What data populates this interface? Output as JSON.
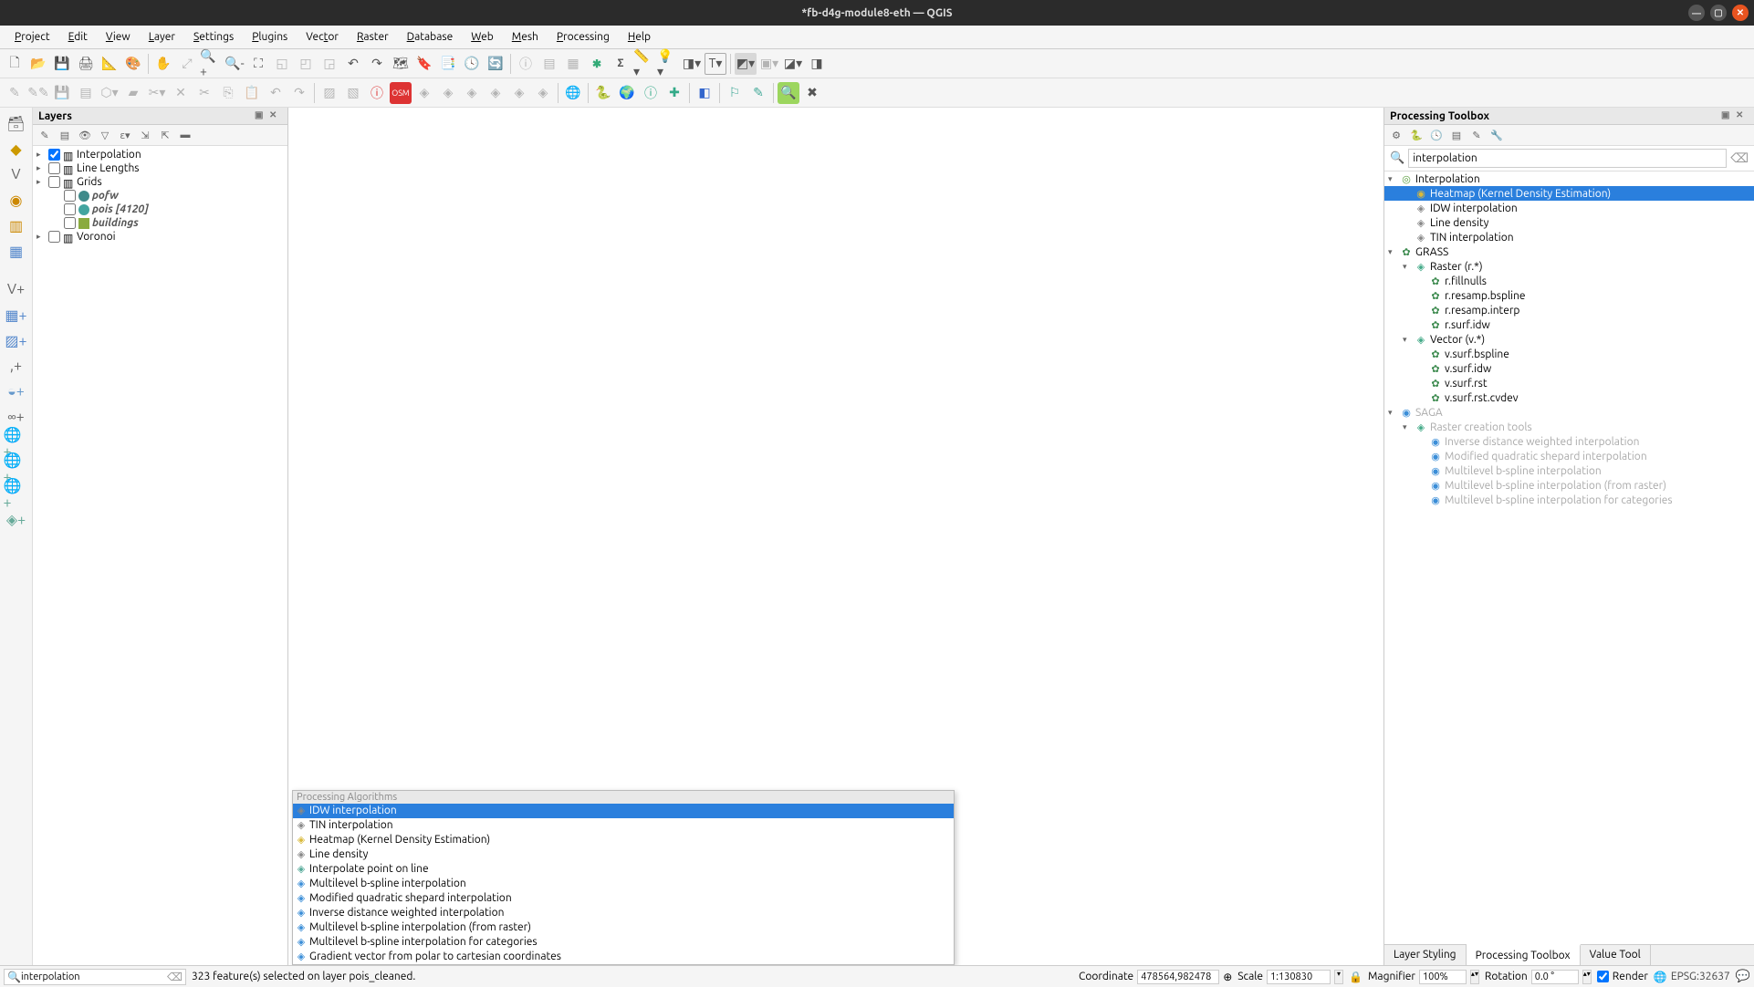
{
  "window": {
    "title": "*fb-d4g-module8-eth — QGIS"
  },
  "menubar": [
    {
      "label": "Project",
      "u": 0
    },
    {
      "label": "Edit",
      "u": 0
    },
    {
      "label": "View",
      "u": 0
    },
    {
      "label": "Layer",
      "u": 0
    },
    {
      "label": "Settings",
      "u": 0
    },
    {
      "label": "Plugins",
      "u": 0
    },
    {
      "label": "Vector",
      "u": 3
    },
    {
      "label": "Raster",
      "u": 0
    },
    {
      "label": "Database",
      "u": 0
    },
    {
      "label": "Web",
      "u": 0
    },
    {
      "label": "Mesh",
      "u": 0
    },
    {
      "label": "Processing",
      "u": 0
    },
    {
      "label": "Help",
      "u": 0
    }
  ],
  "layers_panel": {
    "title": "Layers",
    "items": [
      {
        "type": "group",
        "label": "Interpolation",
        "checked": true,
        "expandable": true
      },
      {
        "type": "group",
        "label": "Line Lengths",
        "checked": false,
        "expandable": true
      },
      {
        "type": "group",
        "label": "Grids",
        "checked": false,
        "expandable": true
      },
      {
        "type": "layer",
        "label": "pofw",
        "checked": false,
        "style": "italic",
        "sym": "point",
        "color": "#3f8a8a",
        "indent": 1
      },
      {
        "type": "layer",
        "label": "pois [4120]",
        "checked": false,
        "style": "italic",
        "sym": "point",
        "color": "#42a5a0",
        "indent": 1
      },
      {
        "type": "layer",
        "label": "buildings",
        "checked": false,
        "style": "italic",
        "sym": "rect",
        "color": "#8aab3f",
        "indent": 1
      },
      {
        "type": "group",
        "label": "Voronoi",
        "checked": false,
        "expandable": true
      }
    ]
  },
  "toolbox": {
    "title": "Processing Toolbox",
    "search_value": "interpolation",
    "tree": [
      {
        "l": 0,
        "t": "g",
        "label": "Interpolation",
        "icon": "qgis",
        "open": true
      },
      {
        "l": 1,
        "t": "a",
        "label": "Heatmap (Kernel Density Estimation)",
        "icon": "hm",
        "selected": true
      },
      {
        "l": 1,
        "t": "a",
        "label": "IDW interpolation",
        "icon": "grey"
      },
      {
        "l": 1,
        "t": "a",
        "label": "Line density",
        "icon": "grey"
      },
      {
        "l": 1,
        "t": "a",
        "label": "TIN interpolation",
        "icon": "grey"
      },
      {
        "l": 0,
        "t": "g",
        "label": "GRASS",
        "icon": "grass",
        "open": true
      },
      {
        "l": 1,
        "t": "g",
        "label": "Raster (r.*)",
        "open": true
      },
      {
        "l": 2,
        "t": "a",
        "label": "r.fillnulls",
        "icon": "grass"
      },
      {
        "l": 2,
        "t": "a",
        "label": "r.resamp.bspline",
        "icon": "grass"
      },
      {
        "l": 2,
        "t": "a",
        "label": "r.resamp.interp",
        "icon": "grass"
      },
      {
        "l": 2,
        "t": "a",
        "label": "r.surf.idw",
        "icon": "grass"
      },
      {
        "l": 1,
        "t": "g",
        "label": "Vector (v.*)",
        "open": true
      },
      {
        "l": 2,
        "t": "a",
        "label": "v.surf.bspline",
        "icon": "grass"
      },
      {
        "l": 2,
        "t": "a",
        "label": "v.surf.idw",
        "icon": "grass"
      },
      {
        "l": 2,
        "t": "a",
        "label": "v.surf.rst",
        "icon": "grass"
      },
      {
        "l": 2,
        "t": "a",
        "label": "v.surf.rst.cvdev",
        "icon": "grass"
      },
      {
        "l": 0,
        "t": "g",
        "label": "SAGA",
        "icon": "saga",
        "open": true,
        "disabled": true
      },
      {
        "l": 1,
        "t": "g",
        "label": "Raster creation tools",
        "open": true,
        "disabled": true
      },
      {
        "l": 2,
        "t": "a",
        "label": "Inverse distance weighted interpolation",
        "icon": "saga",
        "disabled": true
      },
      {
        "l": 2,
        "t": "a",
        "label": "Modified quadratic shepard interpolation",
        "icon": "saga",
        "disabled": true
      },
      {
        "l": 2,
        "t": "a",
        "label": "Multilevel b-spline interpolation",
        "icon": "saga",
        "disabled": true
      },
      {
        "l": 2,
        "t": "a",
        "label": "Multilevel b-spline interpolation (from raster)",
        "icon": "saga",
        "disabled": true
      },
      {
        "l": 2,
        "t": "a",
        "label": "Multilevel b-spline interpolation for categories",
        "icon": "saga",
        "disabled": true
      }
    ],
    "tabs": [
      "Layer Styling",
      "Processing Toolbox",
      "Value Tool"
    ],
    "active_tab": 1
  },
  "locator": {
    "header": "Processing Algorithms",
    "items": [
      {
        "label": "IDW interpolation",
        "icon": "grey",
        "selected": true
      },
      {
        "label": "TIN interpolation",
        "icon": "grey"
      },
      {
        "label": "Heatmap (Kernel Density Estimation)",
        "icon": "hm"
      },
      {
        "label": "Line density",
        "icon": "grey"
      },
      {
        "label": "Interpolate point on line",
        "icon": "qgis"
      },
      {
        "label": "Multilevel b-spline interpolation",
        "icon": "saga"
      },
      {
        "label": "Modified quadratic shepard interpolation",
        "icon": "saga"
      },
      {
        "label": "Inverse distance weighted interpolation",
        "icon": "saga"
      },
      {
        "label": "Multilevel b-spline interpolation (from raster)",
        "icon": "saga"
      },
      {
        "label": "Multilevel b-spline interpolation for categories",
        "icon": "saga"
      },
      {
        "label": "Gradient vector from polar to cartesian coordinates",
        "icon": "saga"
      }
    ]
  },
  "statusbar": {
    "locator_value": "interpolation",
    "message": "323 feature(s) selected on layer pois_cleaned.",
    "coordinate_label": "Coordinate",
    "coordinate": "478564,982478",
    "scale_label": "Scale",
    "scale": "1:130830",
    "magnifier_label": "Magnifier",
    "magnifier": "100%",
    "rotation_label": "Rotation",
    "rotation": "0.0 °",
    "render_label": "Render",
    "crs": "EPSG:32637"
  }
}
